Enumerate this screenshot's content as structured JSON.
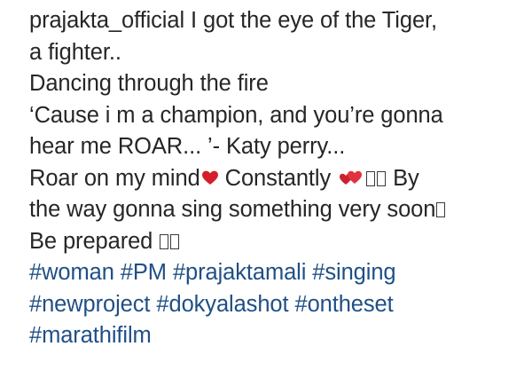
{
  "caption": {
    "username": "prajakta_official",
    "line1_text": " I got the eye of the Tiger,",
    "line2": "a fighter..",
    "line3": "Dancing through the fire",
    "line4": "‘Cause i m a champion, and you’re gonna",
    "line5": "hear me ROAR... ’- Katy perry...",
    "line6_a": "Roar on my mind",
    "line6_b": " Constantly ",
    "line6_c": " By",
    "line7": "the way gonna sing something very soon",
    "line8": "Be prepared "
  },
  "icons": {
    "heart": "red-heart-icon",
    "two_hearts": "two-hearts-icon",
    "missing_glyph": "missing-glyph-box-icon"
  },
  "colors": {
    "text": "#262626",
    "hashtag": "#1f4f86",
    "heart": "#d21f2b"
  },
  "hashtags": [
    "#woman",
    "#PM",
    "#prajaktamali",
    "#singing",
    "#newproject",
    "#dokyalashot",
    "#ontheset",
    "#marathifilm"
  ]
}
